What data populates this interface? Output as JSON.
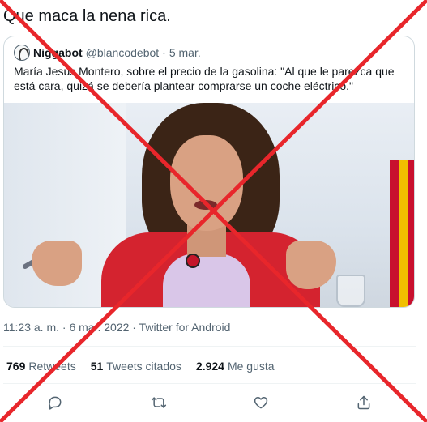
{
  "tweet": {
    "text": "Que maca la nena rica."
  },
  "quote": {
    "author_name": "Niggabot",
    "author_handle": "@blancodebot",
    "separator": "·",
    "date": "5 mar.",
    "text": "María Jesús Montero, sobre el precio de la gasolina: \"Al que le parezca que está cara, quizá se debería plantear comprarse un coche eléctrico.\""
  },
  "meta": {
    "time": "11:23 a. m.",
    "separator": "·",
    "date": "6 mar. 2022",
    "source": "Twitter for Android"
  },
  "stats": {
    "retweets_count": "769",
    "retweets_label": "Retweets",
    "quotes_count": "51",
    "quotes_label": "Tweets citados",
    "likes_count": "2.924",
    "likes_label": "Me gusta"
  },
  "actions": [
    {
      "icon": "reply-icon"
    },
    {
      "icon": "retweet-icon"
    },
    {
      "icon": "like-icon"
    },
    {
      "icon": "share-icon"
    }
  ],
  "colors": {
    "overlay_x": "#e8262b",
    "text_primary": "#0f1419",
    "text_secondary": "#536471",
    "border": "#cfd9de"
  }
}
